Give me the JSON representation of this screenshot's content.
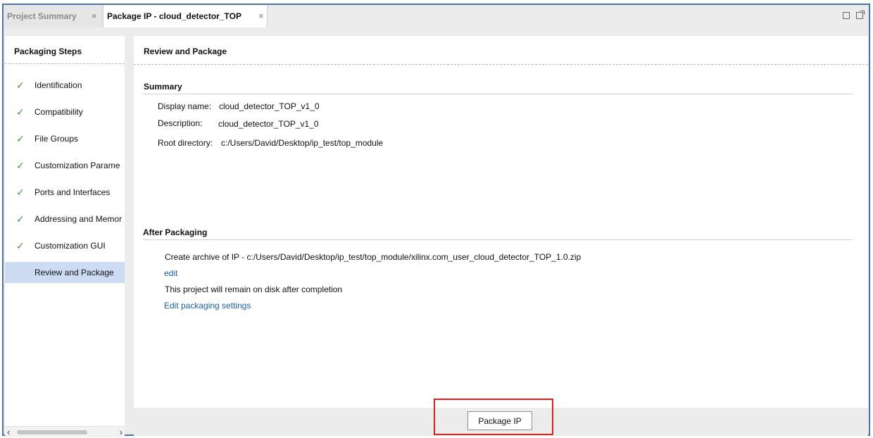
{
  "tabs": [
    {
      "label": "Project Summary",
      "active": false
    },
    {
      "label": "Package IP - cloud_detector_TOP",
      "active": true
    }
  ],
  "close_glyph": "×",
  "window_icons": [
    "maximize-icon",
    "float-icon"
  ],
  "left_panel": {
    "title": "Packaging Steps",
    "steps": [
      {
        "label": "Identification",
        "done": true
      },
      {
        "label": "Compatibility",
        "done": true
      },
      {
        "label": "File Groups",
        "done": true
      },
      {
        "label": "Customization Parame",
        "done": true
      },
      {
        "label": "Ports and Interfaces",
        "done": true
      },
      {
        "label": "Addressing and Memor",
        "done": true
      },
      {
        "label": "Customization GUI",
        "done": true
      },
      {
        "label": "Review and Package",
        "done": false,
        "selected": true
      }
    ],
    "check_glyph": "✓"
  },
  "main": {
    "title": "Review and Package",
    "summary": {
      "title": "Summary",
      "display_name_label": "Display name:",
      "display_name_value": "cloud_detector_TOP_v1_0",
      "description_label": "Description:",
      "description_value": "cloud_detector_TOP_v1_0",
      "root_dir_label": "Root directory:",
      "root_dir_value": "c:/Users/David/Desktop/ip_test/top_module"
    },
    "after_packaging": {
      "title": "After Packaging",
      "archive_text": "Create archive of IP - c:/Users/David/Desktop/ip_test/top_module/xilinx.com_user_cloud_detector_TOP_1.0.zip",
      "edit_link": "edit",
      "remain_text": "This project will remain on disk after completion",
      "settings_link": "Edit packaging settings"
    }
  },
  "footer": {
    "package_button": "Package IP",
    "highlight_color": "#dd2222"
  },
  "colors": {
    "accent": "#4a72b4",
    "selected_bg": "#cddcf3",
    "check": "#3c9a3c",
    "link": "#1a5fb4"
  }
}
